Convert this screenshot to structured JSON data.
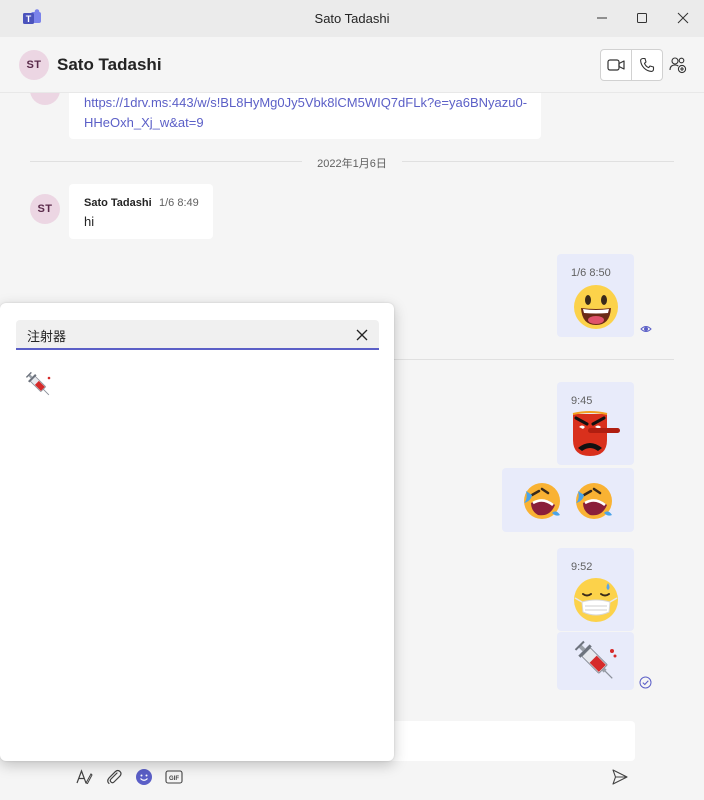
{
  "window": {
    "title": "Sato Tadashi"
  },
  "header": {
    "avatar_initials": "ST",
    "contact_name": "Sato Tadashi"
  },
  "messages": {
    "link_message": {
      "avatar_initials": "ST",
      "link_line1": "https://1drv.ms:443/w/s!BL8HyMg0Jy5Vbk8lCM5WIQ7dFLk?e=ya6BNyazu0-",
      "link_line2": "HHeOxh_Xj_w&at=9"
    },
    "date_divider": "2022年1月6日",
    "incoming": {
      "avatar_initials": "ST",
      "sender": "Sato Tadashi",
      "time": "1/6 8:49",
      "text": "hi"
    },
    "outgoing": [
      {
        "time": "1/6 8:50",
        "emoji": "grinning-face"
      },
      {
        "time": "9:45",
        "emoji": "tengu-face"
      },
      {
        "time": "",
        "emoji": "rolling-on-floor-laughing x2"
      },
      {
        "time": "9:52",
        "emoji": "sick-face-with-mask"
      },
      {
        "time": "",
        "emoji": "syringe"
      }
    ]
  },
  "emoji_picker": {
    "search_value": "注射器",
    "results": [
      "syringe"
    ]
  },
  "compose": {
    "tools": [
      "format-icon",
      "attach-icon",
      "emoji-icon",
      "gif-icon"
    ],
    "send": "send-icon"
  },
  "colors": {
    "accent": "#5b5fc7",
    "outgoing_bubble": "#e8ebfa",
    "incoming_bubble": "#ffffff",
    "avatar_bg": "#ecd6e3"
  }
}
